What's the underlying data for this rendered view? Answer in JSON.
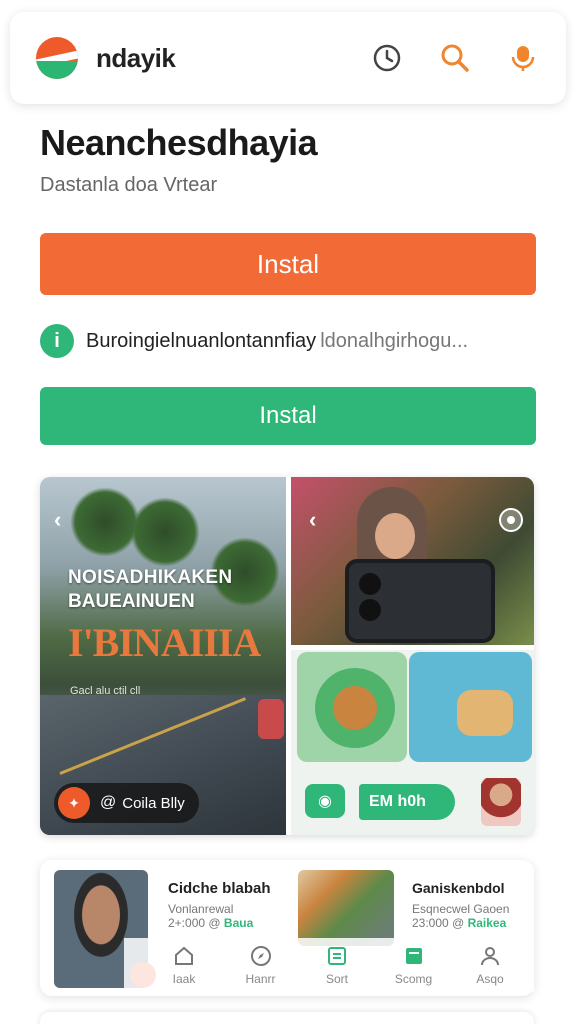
{
  "header": {
    "app_name": "ndayik",
    "icons": [
      "history-icon",
      "search-icon",
      "microphone-icon"
    ],
    "colors": {
      "brand_orange": "#ef5a2a",
      "brand_green": "#2bb673"
    }
  },
  "page": {
    "title": "Neanchesdhayia",
    "subtitle": "Dastanla doa Vrtear"
  },
  "actions": {
    "install_primary": "Instal",
    "install_secondary": "Instal"
  },
  "notice": {
    "icon": "info-icon",
    "text": "Buroingielnuanlontannfiay",
    "text_muted": "ldonalhgirhogu..."
  },
  "gallery": {
    "promo": {
      "line1": "NOISADHIKAKEN",
      "line2": "BAUEAINUEN",
      "big": "I'BINAIIIA",
      "small": "Gacl alu ctil cll"
    },
    "pill_label": "Coila Blly",
    "banner_text": "EM h0h"
  },
  "feed": {
    "item1": {
      "title": "Cidche blabah",
      "meta": "Vonlanrewal",
      "count": "2+:000",
      "tag": "Baua"
    },
    "item2": {
      "title": "Ganiskenbdol",
      "meta": "Esqnecwel Gaoen",
      "count": "23:000",
      "tag": "Raikea"
    }
  },
  "tabs": [
    {
      "label": "Iaak",
      "icon": "home-icon"
    },
    {
      "label": "Hanrr",
      "icon": "compass-icon"
    },
    {
      "label": "Sort",
      "icon": "list-icon"
    },
    {
      "label": "Scomg",
      "icon": "bookmark-icon"
    },
    {
      "label": "Asqo",
      "icon": "profile-icon"
    }
  ]
}
